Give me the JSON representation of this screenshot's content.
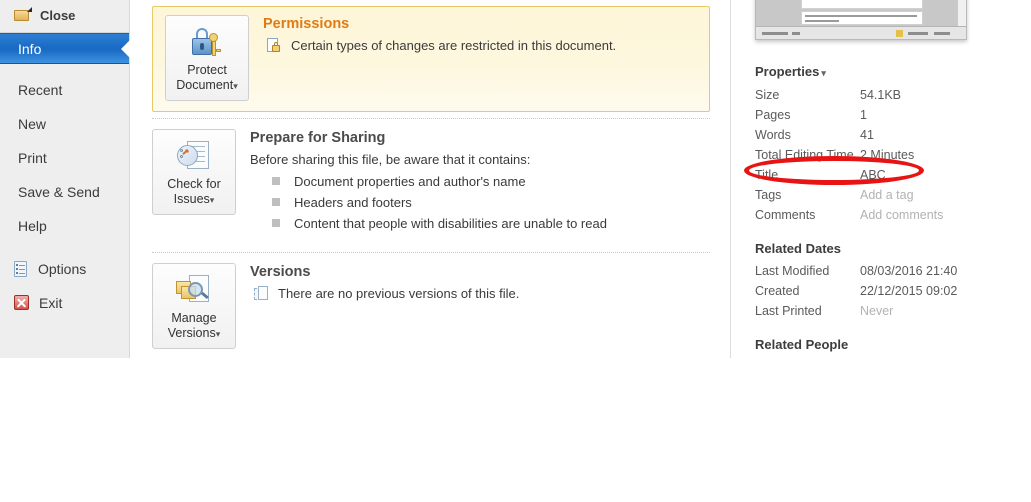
{
  "nav": {
    "close": {
      "label": "Close",
      "icon": "folder-close-icon"
    },
    "items": [
      {
        "label": "Info",
        "active": true
      },
      {
        "label": "Recent",
        "active": false
      },
      {
        "label": "New",
        "active": false
      },
      {
        "label": "Print",
        "active": false
      },
      {
        "label": "Save & Send",
        "active": false
      },
      {
        "label": "Help",
        "active": false
      }
    ],
    "options": {
      "label": "Options",
      "icon": "options-icon"
    },
    "exit": {
      "label": "Exit",
      "icon": "exit-icon"
    }
  },
  "sections": {
    "permissions": {
      "title": "Permissions",
      "button_line1": "Protect",
      "button_line2": "Document",
      "button_caret": "▾",
      "button_icon": "padlock-key-icon",
      "status_icon": "document-lock-icon",
      "status_text": "Certain types of changes are restricted in this document.",
      "accent_color": "#e07b14",
      "background_color": "#fdf7de",
      "border_color": "#e8c96a"
    },
    "prepare_for_sharing": {
      "title": "Prepare for Sharing",
      "button_line1": "Check for",
      "button_line2": "Issues",
      "button_caret": "▾",
      "button_icon": "checklist-document-icon",
      "intro": "Before sharing this file, be aware that it contains:",
      "bullets": [
        "Document properties and author's name",
        "Headers and footers",
        "Content that people with disabilities are unable to read"
      ]
    },
    "versions": {
      "title": "Versions",
      "button_line1": "Manage",
      "button_line2": "Versions",
      "button_caret": "▾",
      "button_icon": "manage-versions-icon",
      "status_icon": "version-history-icon",
      "status_text": "There are no previous versions of this file."
    }
  },
  "right_pane": {
    "thumbnail_name": "document-preview-thumbnail",
    "properties_header": "Properties",
    "properties_caret": "▾",
    "properties": [
      {
        "key": "Size",
        "value": "54.1KB",
        "placeholder": false
      },
      {
        "key": "Pages",
        "value": "1",
        "placeholder": false
      },
      {
        "key": "Words",
        "value": "41",
        "placeholder": false
      },
      {
        "key": "Total Editing Time",
        "value": "2 Minutes",
        "placeholder": false
      },
      {
        "key": "Title",
        "value": "ABC",
        "placeholder": false
      },
      {
        "key": "Tags",
        "value": "Add a tag",
        "placeholder": true
      },
      {
        "key": "Comments",
        "value": "Add comments",
        "placeholder": true
      }
    ],
    "related_dates_header": "Related Dates",
    "related_dates": [
      {
        "key": "Last Modified",
        "value": "08/03/2016 21:40",
        "placeholder": false
      },
      {
        "key": "Created",
        "value": "22/12/2015 09:02",
        "placeholder": false
      },
      {
        "key": "Last Printed",
        "value": "Never",
        "placeholder": true
      }
    ],
    "related_people_header": "Related People"
  },
  "annotation": {
    "name": "red-ellipse-highlight",
    "target": "Title",
    "color": "#e81313"
  }
}
